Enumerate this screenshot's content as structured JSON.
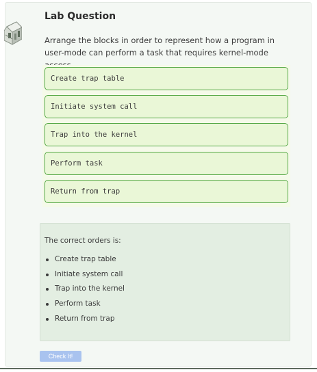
{
  "lab": {
    "title": "Lab Question",
    "prompt": "Arrange the blocks in order to represent how a program in user-mode can perform a task that requires kernel-mode access."
  },
  "blocks": [
    "Create trap table",
    "Initiate system call",
    "Trap into the kernel",
    "Perform task",
    "Return from trap"
  ],
  "answer": {
    "intro": "The correct orders is:",
    "items": [
      "Create trap table",
      "Initiate system call",
      "Trap into the kernel",
      "Perform task",
      "Return from trap"
    ]
  },
  "check_button": {
    "label": "Check It!"
  },
  "icons": {
    "logo": "cube-logo-icon"
  },
  "colors": {
    "block_border": "#55a845",
    "block_fill": "#eaf7d7",
    "answer_bg": "#e3eee2",
    "button": "#a9c3ef"
  }
}
